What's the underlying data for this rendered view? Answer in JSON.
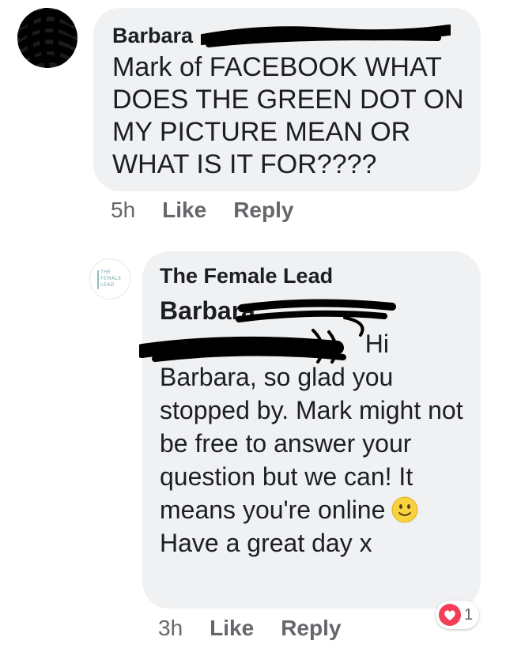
{
  "comment_1": {
    "author": "Barbara",
    "text": "Mark of FACEBOOK WHAT DOES THE GREEN DOT ON MY PICTURE MEAN OR WHAT IS IT FOR????",
    "time": "5h",
    "like_label": "Like",
    "reply_label": "Reply",
    "avatar_icon": "redacted-profile-photo"
  },
  "comment_2": {
    "author": "The Female Lead",
    "mention": "Barbara",
    "greeting": "Hi",
    "lines_before_emoji": "Barbara, so glad you stopped by. Mark might not be free to answer your question but we can! It means you're online",
    "emoji_icon": "slightly-smiling-face-icon",
    "lines_after_emoji": "Have a great day x",
    "time": "3h",
    "like_label": "Like",
    "reply_label": "Reply",
    "reaction_icon": "love-reaction-icon",
    "reaction_count": "1",
    "avatar_logo": "THE\nFEMALE\nLEAD"
  },
  "colors": {
    "bubble": "#f0f1f3",
    "meta_text": "#65676b",
    "love_reaction": "#f33e58",
    "logo": "#7aa9ae"
  }
}
